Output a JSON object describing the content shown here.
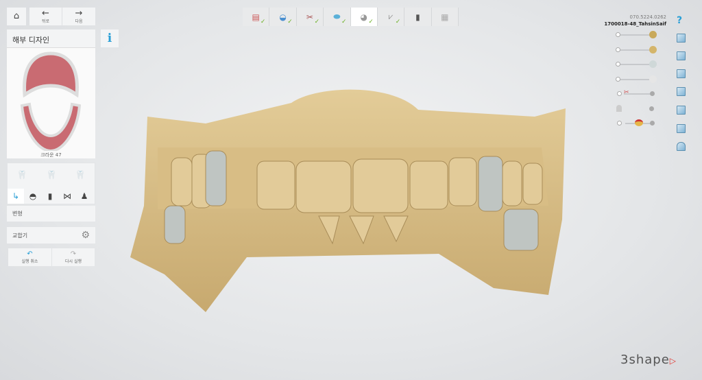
{
  "nav": {
    "home_icon": "home-icon",
    "back_label": "뒤로",
    "next_label": "다음"
  },
  "panel": {
    "title": "해부 디자인",
    "info_label": "i",
    "preview_caption": "크라운 47",
    "transform_label": "변형",
    "articulator_label": "교합기",
    "undo_label": "실행 취소",
    "redo_label": "다시 실행"
  },
  "tools": [
    "ai-design-icon",
    "crown-tooth-icon",
    "multi-tooth-icon",
    "move-icon",
    "anatomy-icon",
    "spray-icon",
    "connector-icon",
    "morph-icon"
  ],
  "workflow": {
    "steps": [
      {
        "icon": "order-form-icon",
        "done": true
      },
      {
        "icon": "scan-icon",
        "done": true
      },
      {
        "icon": "trim-icon",
        "done": true
      },
      {
        "icon": "margin-icon",
        "done": true
      },
      {
        "icon": "crown-icon",
        "done": true,
        "active": true
      },
      {
        "icon": "connector-icon",
        "done": true
      },
      {
        "icon": "implant-icon",
        "done": false
      },
      {
        "icon": "output-icon",
        "done": false
      }
    ]
  },
  "case": {
    "phone": "070.5224.0262",
    "id": "1700018-48_TahsinSaif"
  },
  "sliders": [
    {
      "icon": "upper-jaw-icon",
      "value": 100
    },
    {
      "icon": "lower-jaw-icon",
      "value": 100
    },
    {
      "icon": "upper-crown-icon",
      "value": 100
    },
    {
      "icon": "lower-crown-icon",
      "value": 100
    },
    {
      "icon": "clip-icon",
      "value": 100
    },
    {
      "icon": "ghost-icon",
      "value": 100
    },
    {
      "icon": "antagonist-icon",
      "value": 50
    }
  ],
  "right_icons": [
    "help-icon",
    "view-front-icon",
    "view-back-icon",
    "view-left-icon",
    "view-right-icon",
    "view-top-icon",
    "view-bottom-icon",
    "screenshot-icon"
  ],
  "help_label": "?",
  "brand": "3shape",
  "colors": {
    "accent": "#2a9fd6",
    "check": "#6ab023",
    "model": "#d9c08e",
    "crown": "#b9c2c2"
  }
}
